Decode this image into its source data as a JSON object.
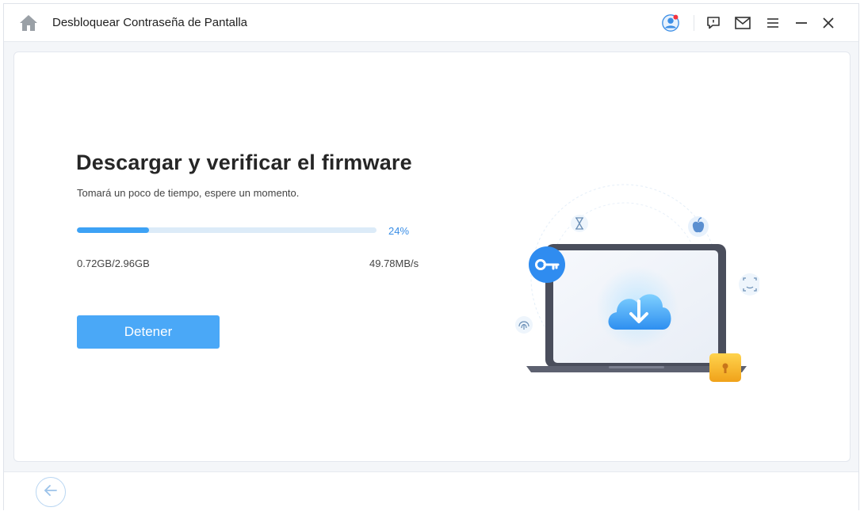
{
  "window": {
    "title": "Desbloquear Contraseña de Pantalla"
  },
  "titlebar_icons": [
    "home-icon",
    "user-account-icon",
    "feedback-icon",
    "mail-icon",
    "menu-icon",
    "minimize-icon",
    "close-icon"
  ],
  "main": {
    "heading": "Descargar y verificar el firmware",
    "subtext": "Tomará un poco de tiempo, espere un momento.",
    "progress": {
      "percent_label": "24%",
      "fraction": 0.24,
      "downloaded": "0.72GB/2.96GB",
      "speed": "49.78MB/s"
    },
    "stop_label": "Detener"
  },
  "illustration_icons": [
    "key-icon",
    "hourglass-icon",
    "apple-icon",
    "face-id-icon",
    "fingerprint-icon",
    "cloud-download-icon",
    "padlock-icon",
    "laptop-icon"
  ],
  "colors": {
    "accent": "#3da2f5",
    "button": "#4aa8f7",
    "track": "#dcebf8",
    "notification_dot": "#f5333f"
  },
  "footer": {
    "back_icon": "arrow-left-icon"
  }
}
